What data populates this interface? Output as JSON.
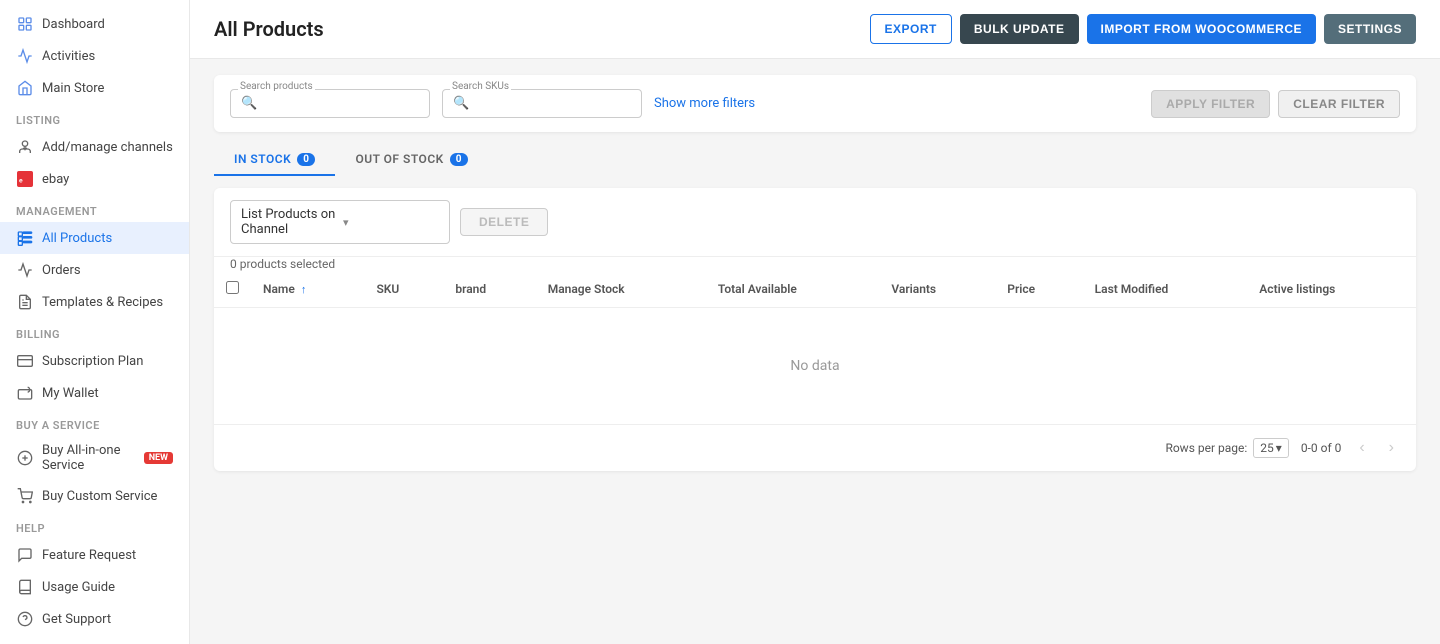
{
  "sidebar": {
    "items": [
      {
        "id": "dashboard",
        "label": "Dashboard",
        "icon": "dashboard",
        "section": null
      },
      {
        "id": "activities",
        "label": "Activities",
        "icon": "activities",
        "section": null
      },
      {
        "id": "main-store",
        "label": "Main Store",
        "icon": "store",
        "section": null
      },
      {
        "id": "add-channels",
        "label": "Add/manage channels",
        "icon": "add-channels",
        "section": "Listing"
      },
      {
        "id": "ebay",
        "label": "ebay",
        "icon": "ebay",
        "section": "Listing"
      },
      {
        "id": "all-products",
        "label": "All Products",
        "icon": "all-products",
        "section": "Management",
        "active": true
      },
      {
        "id": "orders",
        "label": "Orders",
        "icon": "orders",
        "section": "Management"
      },
      {
        "id": "templates",
        "label": "Templates & Recipes",
        "icon": "templates",
        "section": "Management"
      },
      {
        "id": "subscription",
        "label": "Subscription Plan",
        "icon": "subscription",
        "section": "Billing"
      },
      {
        "id": "wallet",
        "label": "My Wallet",
        "icon": "wallet",
        "section": "Billing"
      },
      {
        "id": "all-in-one",
        "label": "Buy All-in-one Service",
        "icon": "all-in-one",
        "section": "Buy a service",
        "badge": "NEW"
      },
      {
        "id": "custom-service",
        "label": "Buy Custom Service",
        "icon": "custom-service",
        "section": "Buy a service"
      },
      {
        "id": "feature-request",
        "label": "Feature Request",
        "icon": "feature-request",
        "section": "Help"
      },
      {
        "id": "usage-guide",
        "label": "Usage Guide",
        "icon": "usage-guide",
        "section": "Help"
      },
      {
        "id": "get-support",
        "label": "Get Support",
        "icon": "get-support",
        "section": "Help"
      }
    ]
  },
  "header": {
    "title": "All Products",
    "buttons": {
      "export": "EXPORT",
      "bulk_update": "BULK UPDATE",
      "import": "IMPORT FROM WOOCOMMERCE",
      "settings": "SETTINGS"
    }
  },
  "filters": {
    "search_products_label": "Search products",
    "search_products_placeholder": "",
    "search_skus_label": "Search SKUs",
    "search_skus_placeholder": "",
    "show_more": "Show more filters",
    "apply_btn": "APPLY FILTER",
    "clear_btn": "CLEAR FILTER"
  },
  "tabs": [
    {
      "id": "in-stock",
      "label": "IN STOCK",
      "count": "0",
      "active": true
    },
    {
      "id": "out-of-stock",
      "label": "OUT OF STOCK",
      "count": "0",
      "active": false
    }
  ],
  "table": {
    "dropdown_label": "List Products on Channel",
    "delete_btn": "DELETE",
    "selected_count": "0 products selected",
    "columns": [
      "Name",
      "SKU",
      "brand",
      "Manage Stock",
      "Total Available",
      "Variants",
      "Price",
      "Last Modified",
      "Active listings"
    ],
    "no_data": "No data"
  },
  "pagination": {
    "rows_per_page_label": "Rows per page:",
    "rows_value": "25",
    "page_info": "0-0 of 0"
  }
}
